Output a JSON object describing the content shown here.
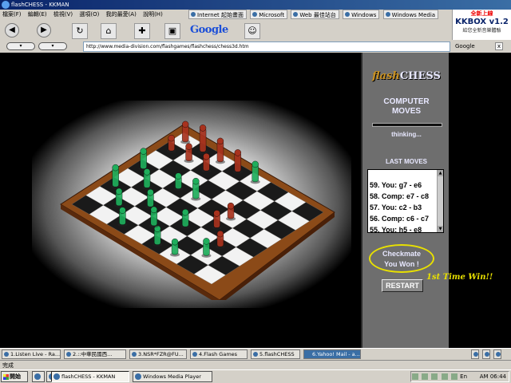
{
  "window": {
    "title": "flashCHESS - KKMAN"
  },
  "menu": [
    "檔案(F)",
    "編輯(E)",
    "檢視(V)",
    "選項(O)",
    "我的最愛(A)",
    "說明(H)"
  ],
  "links": [
    "Internet 起始畫面",
    "Microsoft",
    "Web 最佳站台",
    "Windows",
    "Windows Media"
  ],
  "kkbox": {
    "new_label": "全新上線",
    "brand": "KKBOX v1.2",
    "subtitle": "給您全新音樂體驗"
  },
  "toolbar": {
    "google_label": "Google"
  },
  "address": {
    "url": "http://www.media-division.com/flashgames/flashchess/chess3d.htm",
    "google_label": "Google",
    "close_label": "x"
  },
  "game": {
    "logo_flash": "flash",
    "logo_chess": "CHESS",
    "computer_moves_label": "COMPUTER MOVES",
    "thinking_label": "thinking...",
    "last_moves_label": "LAST MOVES",
    "moves": [
      "59. You:    g7  - e6",
      "58. Comp: e7  - c8",
      "57. You:    c2  - b3",
      "56. Comp: c6  - c7",
      "55. You:    h5  - e8"
    ],
    "checkmate_line1": "Checkmate",
    "checkmate_line2": "You Won !",
    "restart_label": "RESTART",
    "first_win_label": "1st Time Win!!"
  },
  "windows_bar": [
    "1.Listen Live - Ra...",
    "2.::中華民國西...",
    "3.NSR*FZR@FU...",
    "4.Flash Games",
    "5.flashCHESS",
    "6.Yahoo! Mail - a..."
  ],
  "status": {
    "text": "完成"
  },
  "taskbar": {
    "start_label": "開始",
    "tasks": [
      "flashCHESS - KKMAN",
      "Windows Media Player"
    ],
    "lang": "En",
    "clock": "AM 06:44"
  },
  "colors": {
    "panel_bg": "#6e6e6e",
    "panel_text": "#e8e8ff",
    "highlight": "#e8e000",
    "board_frame": "#8b4a18",
    "green_piece": "#1fae5c",
    "red_piece": "#a8321e"
  }
}
